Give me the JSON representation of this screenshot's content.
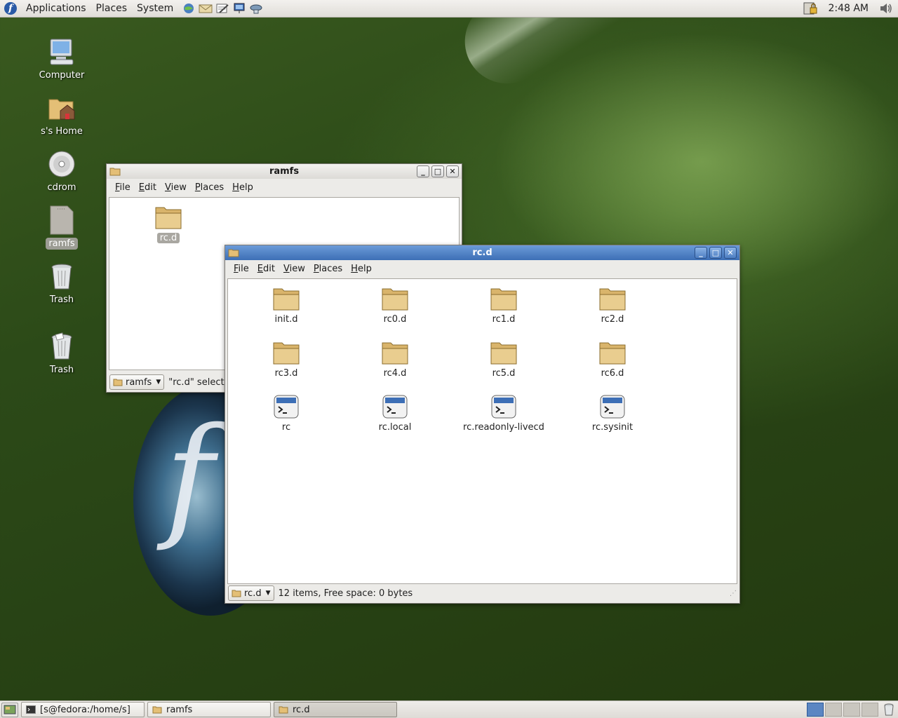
{
  "top_panel": {
    "menus": [
      "Applications",
      "Places",
      "System"
    ],
    "launchers": [
      "web-browser-icon",
      "email-icon",
      "text-editor-icon",
      "presentation-icon",
      "network-icon"
    ],
    "clock": "2:48 AM"
  },
  "desktop": {
    "icons": [
      {
        "label": "Computer",
        "icon": "computer-icon"
      },
      {
        "label": "s's Home",
        "icon": "home-folder-icon"
      },
      {
        "label": "cdrom",
        "icon": "cdrom-icon"
      },
      {
        "label": "ramfs",
        "icon": "drive-icon",
        "selected": true
      },
      {
        "label": "Trash",
        "icon": "trash-icon"
      },
      {
        "label": "Trash",
        "icon": "trash-full-icon"
      }
    ]
  },
  "window_ramfs": {
    "title": "ramfs",
    "menu": [
      "File",
      "Edit",
      "View",
      "Places",
      "Help"
    ],
    "items": [
      {
        "label": "rc.d",
        "type": "folder",
        "selected": true
      }
    ],
    "location": "ramfs",
    "status": "\"rc.d\" selecte"
  },
  "window_rcd": {
    "title": "rc.d",
    "menu": [
      "File",
      "Edit",
      "View",
      "Places",
      "Help"
    ],
    "items": [
      {
        "label": "init.d",
        "type": "folder"
      },
      {
        "label": "rc0.d",
        "type": "folder"
      },
      {
        "label": "rc1.d",
        "type": "folder"
      },
      {
        "label": "rc2.d",
        "type": "folder"
      },
      {
        "label": "rc3.d",
        "type": "folder"
      },
      {
        "label": "rc4.d",
        "type": "folder"
      },
      {
        "label": "rc5.d",
        "type": "folder"
      },
      {
        "label": "rc6.d",
        "type": "folder"
      },
      {
        "label": "rc",
        "type": "script"
      },
      {
        "label": "rc.local",
        "type": "script"
      },
      {
        "label": "rc.readonly-livecd",
        "type": "script"
      },
      {
        "label": "rc.sysinit",
        "type": "script"
      }
    ],
    "location": "rc.d",
    "status": "12 items, Free space: 0 bytes"
  },
  "taskbar": {
    "tasks": [
      {
        "label": "[s@fedora:/home/s]",
        "icon": "terminal-icon"
      },
      {
        "label": "ramfs",
        "icon": "folder-icon"
      },
      {
        "label": "rc.d",
        "icon": "folder-icon",
        "active": true
      }
    ]
  },
  "colors": {
    "folder": "#e4bf76",
    "active_title": "#3d6fb6"
  }
}
